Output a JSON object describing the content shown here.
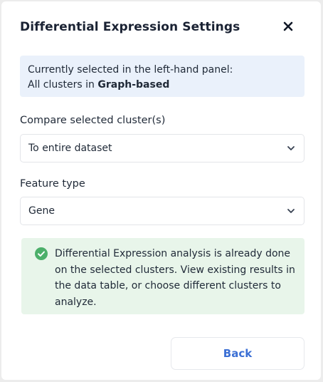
{
  "dialog": {
    "title": "Differential Expression Settings",
    "close_icon": "close-icon"
  },
  "info": {
    "line1": "Currently selected in the left-hand panel:",
    "line2_prefix": "All clusters in ",
    "line2_bold": "Graph-based"
  },
  "compare": {
    "label": "Compare selected cluster(s)",
    "value": "To entire dataset",
    "icon": "chevron-down-icon"
  },
  "feature": {
    "label": "Feature type",
    "value": "Gene",
    "icon": "chevron-down-icon"
  },
  "notice": {
    "icon": "check-circle-icon",
    "text": "Differential Expression analysis is already done on the selected clusters. View existing results in the data table, or choose different clusters to analyze."
  },
  "actions": {
    "back_label": "Back"
  },
  "colors": {
    "accent": "#3b6fd4",
    "success": "#4caf6a",
    "info_bg": "#eaf1fb",
    "success_bg": "#e8f5ea"
  }
}
